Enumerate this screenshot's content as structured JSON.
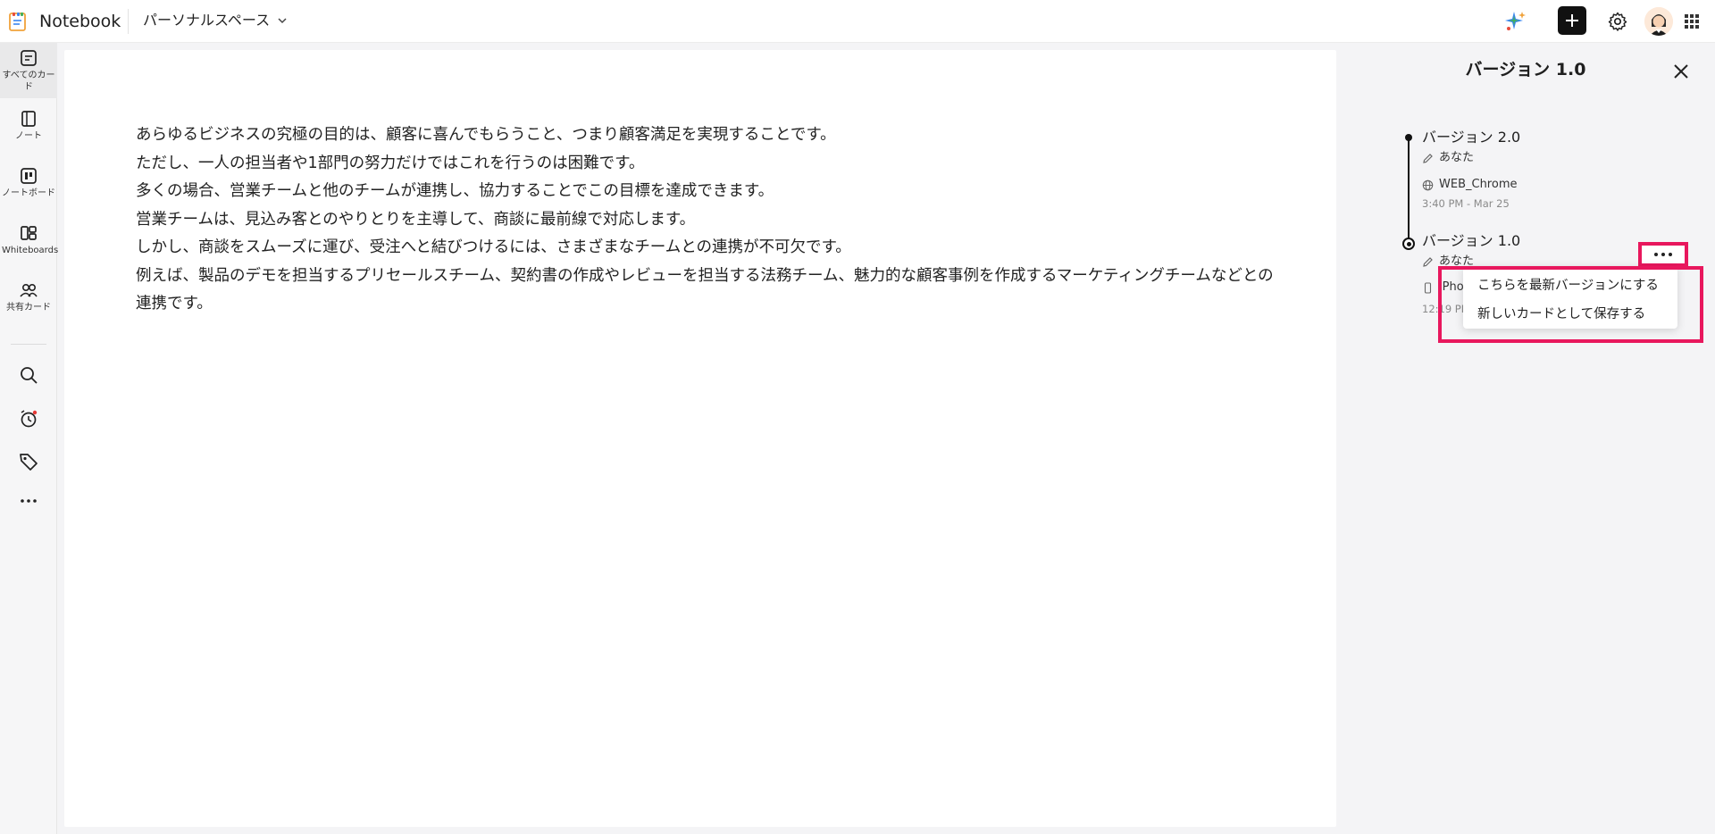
{
  "app": {
    "title": "Notebook",
    "workspace": "パーソナルスペース"
  },
  "topbar": {
    "icons": [
      "sparkle-icon",
      "plus-icon",
      "gear-icon",
      "avatar",
      "apps-grid-icon"
    ]
  },
  "sidebar": {
    "items": [
      {
        "label": "すべてのカード",
        "icon": "all-cards-icon",
        "active": true
      },
      {
        "label": "ノート",
        "icon": "note-icon"
      },
      {
        "label": "ノートボード",
        "icon": "noteboard-icon"
      },
      {
        "label": "Whiteboards",
        "icon": "whiteboard-icon"
      },
      {
        "label": "共有カード",
        "icon": "people-icon"
      }
    ],
    "tools": [
      "search-icon",
      "alarm-icon",
      "tag-icon",
      "more-icon"
    ]
  },
  "document": {
    "paragraphs": [
      "あらゆるビジネスの究極の目的は、顧客に喜んでもらうこと、つまり顧客満足を実現することです。",
      "ただし、一人の担当者や1部門の努力だけではこれを行うのは困難です。",
      "多くの場合、営業チームと他のチームが連携し、協力することでこの目標を達成できます。",
      "営業チームは、見込み客とのやりとりを主導して、商談に最前線で対応します。",
      "しかし、商談をスムーズに運び、受注へと結びつけるには、さまざまなチームとの連携が不可欠です。",
      "例えば、製品のデモを担当するプリセールスチーム、契約書の作成やレビューを担当する法務チーム、魅力的な顧客事例を作成するマーケティングチームなどとの連携です。"
    ]
  },
  "version_panel": {
    "title": "バージョン 1.0",
    "versions": [
      {
        "name": "バージョン 2.0",
        "author": "あなた",
        "device": "WEB_Chrome",
        "time": "3:40 PM - Mar 25"
      },
      {
        "name": "バージョン 1.0",
        "author": "あなた",
        "device": "iPho",
        "time": "12:19 PM"
      }
    ],
    "context_menu": {
      "items": [
        "こちらを最新バージョンにする",
        "新しいカードとして保存する"
      ]
    }
  },
  "colors": {
    "highlight": "#e8175d",
    "accent_dark": "#111111"
  }
}
